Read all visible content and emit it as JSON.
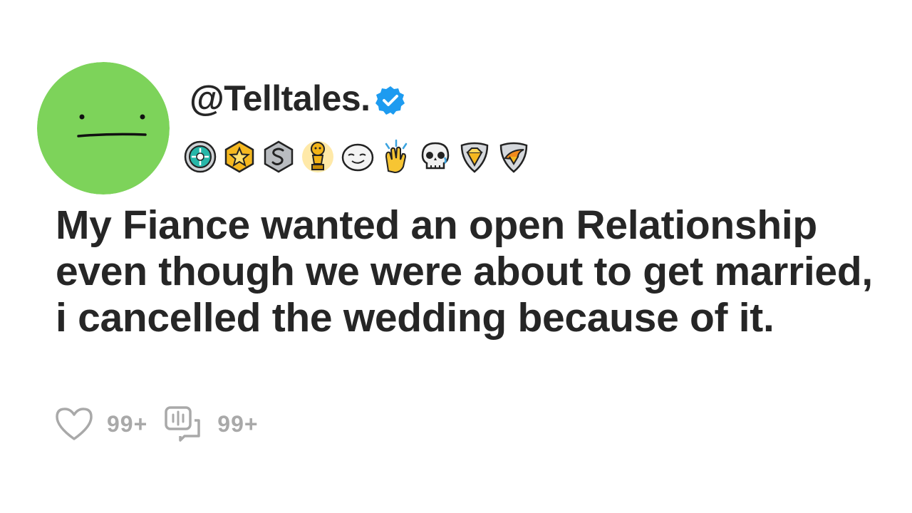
{
  "post": {
    "username": "@Telltales.",
    "title": "My Fiance wanted an open Relationship even though we were about to get married, i cancelled the wedding because of it.",
    "likes": "99+",
    "comments": "99+"
  },
  "badges": [
    {
      "icon": "teal-medal-icon"
    },
    {
      "icon": "gold-star-badge-icon"
    },
    {
      "icon": "silver-s-badge-icon"
    },
    {
      "icon": "gold-trophy-icon"
    },
    {
      "icon": "grinning-face-icon"
    },
    {
      "icon": "clapping-hands-icon"
    },
    {
      "icon": "skull-icon"
    },
    {
      "icon": "gold-gem-shield-icon"
    },
    {
      "icon": "orange-wing-shield-icon"
    }
  ],
  "colors": {
    "avatar": "#7dd35a",
    "text": "#262626",
    "muted": "#a9a9a9",
    "verified": "#1d9bf0"
  }
}
